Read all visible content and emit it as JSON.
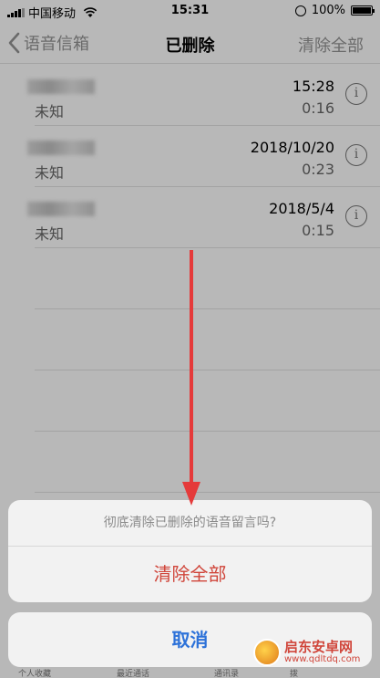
{
  "status_bar": {
    "carrier": "中国移动",
    "time": "15:31",
    "battery": "100%",
    "battery_level": 1.0
  },
  "nav": {
    "back_label": "语音信箱",
    "title": "已删除",
    "action": "清除全部"
  },
  "voicemails": [
    {
      "name_hidden": true,
      "subtitle": "未知",
      "date": "15:28",
      "duration": "0:16"
    },
    {
      "name_hidden": true,
      "subtitle": "未知",
      "date": "2018/10/20",
      "duration": "0:23"
    },
    {
      "name_hidden": true,
      "subtitle": "未知",
      "date": "2018/5/4",
      "duration": "0:15"
    }
  ],
  "action_sheet": {
    "message": "彻底清除已删除的语音留言吗?",
    "destructive": "清除全部",
    "cancel": "取消"
  },
  "tab_bar": {
    "items": [
      "个人收藏",
      "最近通话",
      "通讯录",
      "拨"
    ]
  },
  "watermark": {
    "name": "启东安卓网",
    "url": "www.qdltdq.com"
  },
  "colors": {
    "destructive": "#d0453a",
    "cancel": "#2d72d9",
    "arrow": "#e53a3a"
  }
}
